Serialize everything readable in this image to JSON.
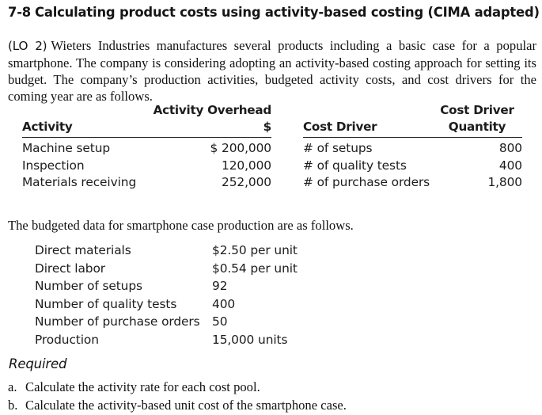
{
  "problem": {
    "number": "7-8",
    "title": "Calculating product costs using activity-based costing (CIMA adapted)",
    "lo_tag": "(LO 2)",
    "intro": "Wieters Industries manufactures several products including a basic case for a popular smartphone. The company is considering adopting an activity-based costing approach for setting its budget. The company’s production activities, budgeted activity costs, and cost drivers for the coming year are as follows."
  },
  "activity_table": {
    "headers": {
      "activity": "Activity",
      "overhead": "Activity Overhead $",
      "cost_driver": "Cost Driver",
      "quantity_line1": "Cost Driver",
      "quantity_line2": "Quantity"
    },
    "rows": [
      {
        "activity": "Machine setup",
        "overhead": "$ 200,000",
        "cost_driver": "# of setups",
        "quantity": "800"
      },
      {
        "activity": "Inspection",
        "overhead": "120,000",
        "cost_driver": "# of quality tests",
        "quantity": "400"
      },
      {
        "activity": "Materials receiving",
        "overhead": "252,000",
        "cost_driver": "# of purchase orders",
        "quantity": "1,800"
      }
    ]
  },
  "budget": {
    "intro": "The budgeted data for smartphone case production are as follows.",
    "rows": [
      {
        "label": "Direct materials",
        "value": "$2.50 per unit"
      },
      {
        "label": "Direct labor",
        "value": "$0.54 per unit"
      },
      {
        "label": "Number of setups",
        "value": "92"
      },
      {
        "label": "Number of quality tests",
        "value": "400"
      },
      {
        "label": "Number of purchase orders",
        "value": "50"
      },
      {
        "label": "Production",
        "value": "15,000 units"
      }
    ]
  },
  "required": {
    "heading": "Required",
    "items": [
      {
        "marker": "a.",
        "text": "Calculate the activity rate for each cost pool."
      },
      {
        "marker": "b.",
        "text": "Calculate the activity-based unit cost of the smartphone case."
      }
    ]
  }
}
